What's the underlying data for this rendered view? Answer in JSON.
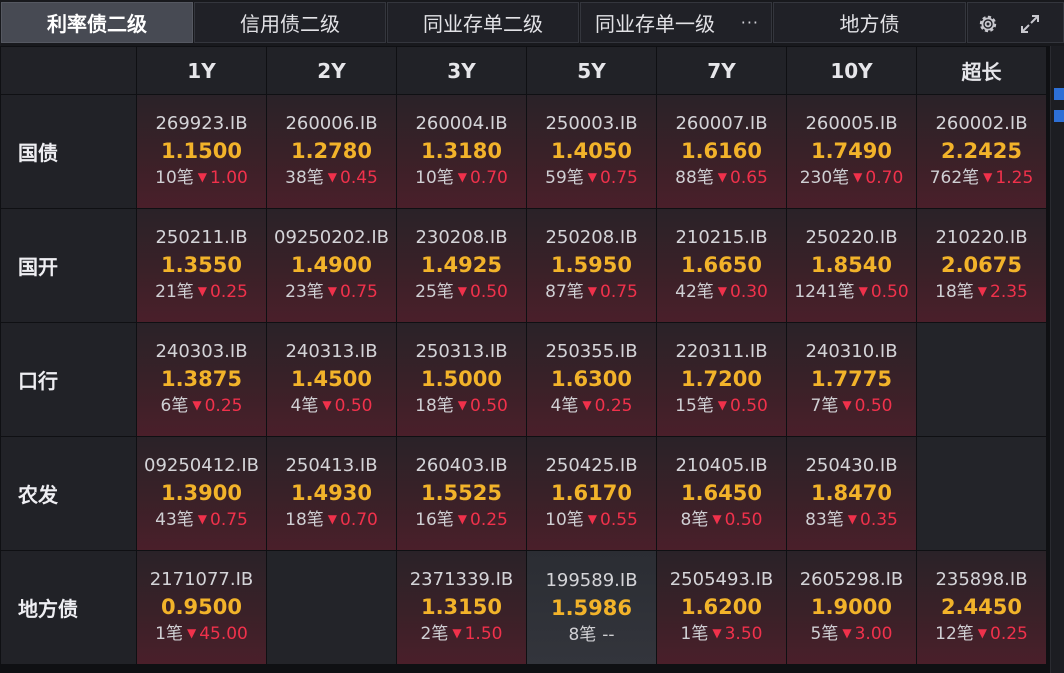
{
  "tabs": [
    {
      "label": "利率债二级",
      "active": true
    },
    {
      "label": "信用债二级",
      "active": false
    },
    {
      "label": "同业存单二级",
      "active": false
    },
    {
      "label": "同业存单一级",
      "active": false,
      "more": "···"
    },
    {
      "label": "地方债",
      "active": false
    }
  ],
  "tools": {
    "settings_icon": "gear-icon",
    "expand_icon": "expand-icon"
  },
  "columns": [
    "1Y",
    "2Y",
    "3Y",
    "5Y",
    "7Y",
    "10Y",
    "超长"
  ],
  "colors": {
    "yield": "#f2b32a",
    "change_down": "#f0314b",
    "cell_bg": "#3a2128"
  },
  "rows": [
    {
      "label": "国债",
      "cells": [
        {
          "code": "269923.IB",
          "yield": "1.1500",
          "count": "10笔",
          "dir": "down",
          "change": "1.00"
        },
        {
          "code": "260006.IB",
          "yield": "1.2780",
          "count": "38笔",
          "dir": "down",
          "change": "0.45"
        },
        {
          "code": "260004.IB",
          "yield": "1.3180",
          "count": "10笔",
          "dir": "down",
          "change": "0.70"
        },
        {
          "code": "250003.IB",
          "yield": "1.4050",
          "count": "59笔",
          "dir": "down",
          "change": "0.75"
        },
        {
          "code": "260007.IB",
          "yield": "1.6160",
          "count": "88笔",
          "dir": "down",
          "change": "0.65"
        },
        {
          "code": "260005.IB",
          "yield": "1.7490",
          "count": "230笔",
          "dir": "down",
          "change": "0.70"
        },
        {
          "code": "260002.IB",
          "yield": "2.2425",
          "count": "762笔",
          "dir": "down",
          "change": "1.25"
        }
      ]
    },
    {
      "label": "国开",
      "cells": [
        {
          "code": "250211.IB",
          "yield": "1.3550",
          "count": "21笔",
          "dir": "down",
          "change": "0.25"
        },
        {
          "code": "09250202.IB",
          "yield": "1.4900",
          "count": "23笔",
          "dir": "down",
          "change": "0.75"
        },
        {
          "code": "230208.IB",
          "yield": "1.4925",
          "count": "25笔",
          "dir": "down",
          "change": "0.50"
        },
        {
          "code": "250208.IB",
          "yield": "1.5950",
          "count": "87笔",
          "dir": "down",
          "change": "0.75"
        },
        {
          "code": "210215.IB",
          "yield": "1.6650",
          "count": "42笔",
          "dir": "down",
          "change": "0.30"
        },
        {
          "code": "250220.IB",
          "yield": "1.8540",
          "count": "1241笔",
          "dir": "down",
          "change": "0.50"
        },
        {
          "code": "210220.IB",
          "yield": "2.0675",
          "count": "18笔",
          "dir": "down",
          "change": "2.35"
        }
      ]
    },
    {
      "label": "口行",
      "cells": [
        {
          "code": "240303.IB",
          "yield": "1.3875",
          "count": "6笔",
          "dir": "down",
          "change": "0.25"
        },
        {
          "code": "240313.IB",
          "yield": "1.4500",
          "count": "4笔",
          "dir": "down",
          "change": "0.50"
        },
        {
          "code": "250313.IB",
          "yield": "1.5000",
          "count": "18笔",
          "dir": "down",
          "change": "0.50"
        },
        {
          "code": "250355.IB",
          "yield": "1.6300",
          "count": "4笔",
          "dir": "down",
          "change": "0.25"
        },
        {
          "code": "220311.IB",
          "yield": "1.7200",
          "count": "15笔",
          "dir": "down",
          "change": "0.50"
        },
        {
          "code": "240310.IB",
          "yield": "1.7775",
          "count": "7笔",
          "dir": "down",
          "change": "0.50"
        },
        null
      ]
    },
    {
      "label": "农发",
      "cells": [
        {
          "code": "09250412.IB",
          "yield": "1.3900",
          "count": "43笔",
          "dir": "down",
          "change": "0.75"
        },
        {
          "code": "250413.IB",
          "yield": "1.4930",
          "count": "18笔",
          "dir": "down",
          "change": "0.70"
        },
        {
          "code": "260403.IB",
          "yield": "1.5525",
          "count": "16笔",
          "dir": "down",
          "change": "0.25"
        },
        {
          "code": "250425.IB",
          "yield": "1.6170",
          "count": "10笔",
          "dir": "down",
          "change": "0.55"
        },
        {
          "code": "210405.IB",
          "yield": "1.6450",
          "count": "8笔",
          "dir": "down",
          "change": "0.50"
        },
        {
          "code": "250430.IB",
          "yield": "1.8470",
          "count": "83笔",
          "dir": "down",
          "change": "0.35"
        },
        null
      ]
    },
    {
      "label": "地方债",
      "cells": [
        {
          "code": "2171077.IB",
          "yield": "0.9500",
          "count": "1笔",
          "dir": "down",
          "change": "45.00"
        },
        null,
        {
          "code": "2371339.IB",
          "yield": "1.3150",
          "count": "2笔",
          "dir": "down",
          "change": "1.50"
        },
        {
          "code": "199589.IB",
          "yield": "1.5986",
          "count": "8笔",
          "dir": "flat",
          "change": "--"
        },
        {
          "code": "2505493.IB",
          "yield": "1.6200",
          "count": "1笔",
          "dir": "down",
          "change": "3.50"
        },
        {
          "code": "2605298.IB",
          "yield": "1.9000",
          "count": "5笔",
          "dir": "down",
          "change": "3.00"
        },
        {
          "code": "235898.IB",
          "yield": "2.4450",
          "count": "12笔",
          "dir": "down",
          "change": "0.25"
        }
      ]
    }
  ]
}
